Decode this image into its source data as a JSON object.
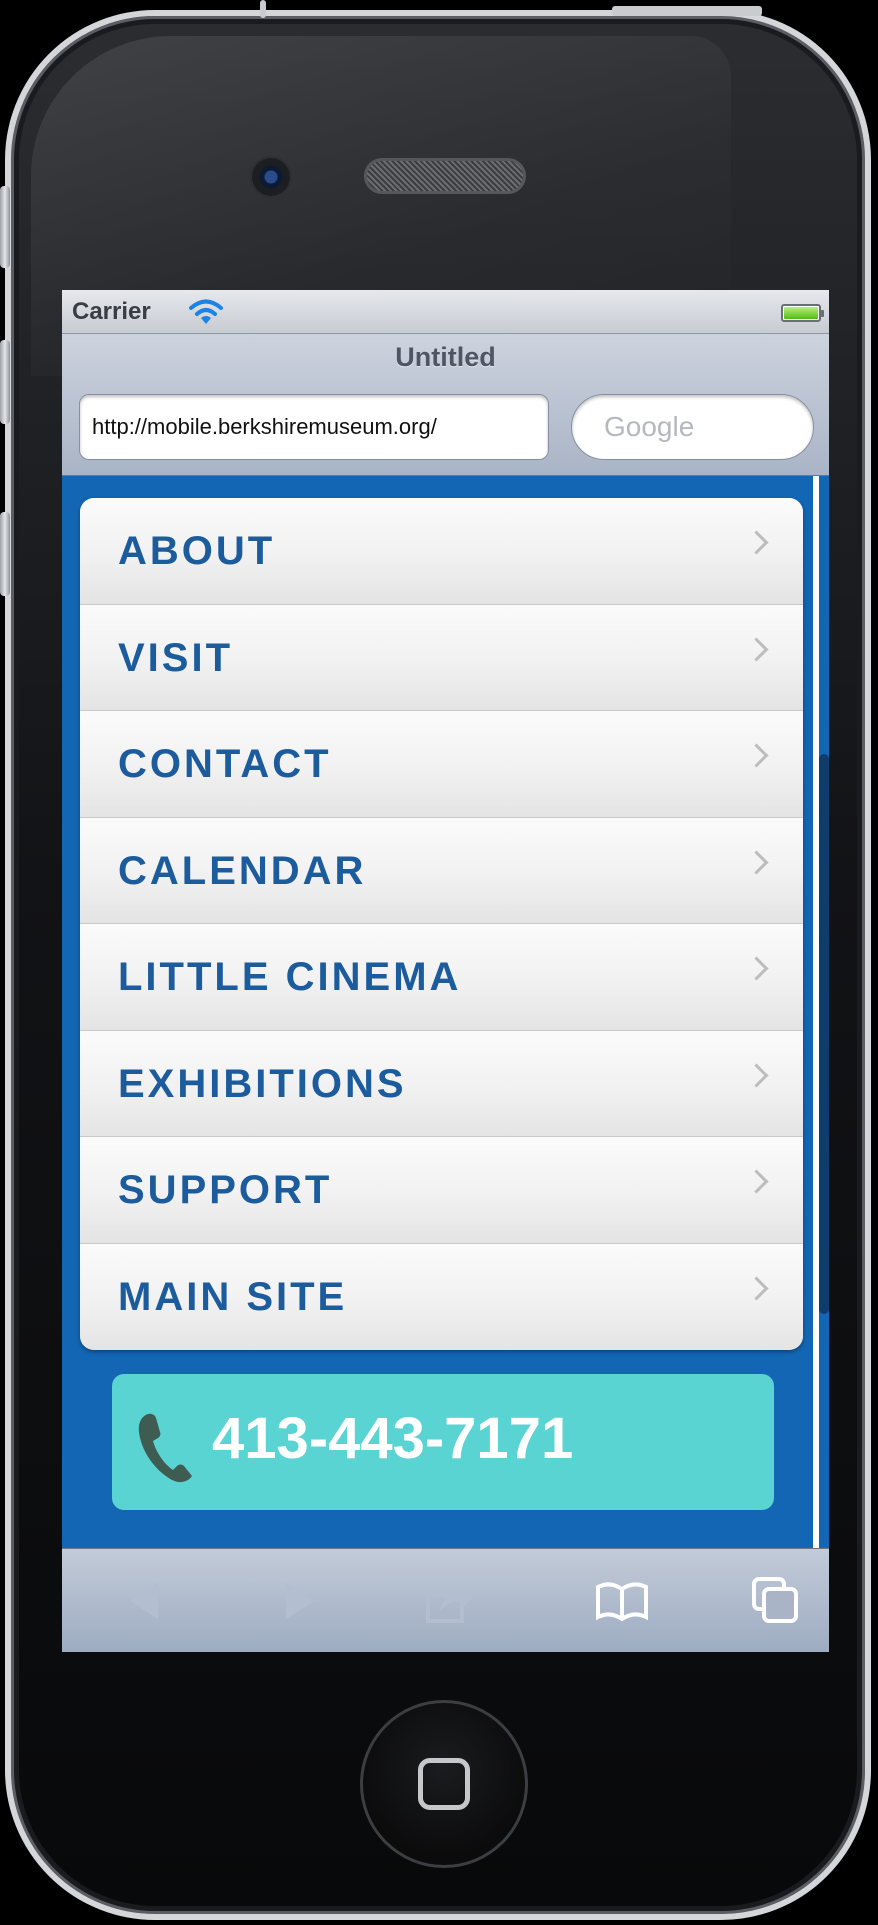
{
  "status_bar": {
    "carrier": "Carrier"
  },
  "browser": {
    "page_title": "Untitled",
    "url": "http://mobile.berkshiremuseum.org/",
    "search_placeholder": "Google"
  },
  "menu": {
    "items": [
      {
        "label": "ABOUT"
      },
      {
        "label": "VISIT"
      },
      {
        "label": "CONTACT"
      },
      {
        "label": "CALENDAR"
      },
      {
        "label": "LITTLE CINEMA"
      },
      {
        "label": "EXHIBITIONS"
      },
      {
        "label": "SUPPORT"
      },
      {
        "label": "MAIN SITE"
      }
    ]
  },
  "call_button": {
    "label": "413-443-7171",
    "icon": "phone-icon"
  },
  "toolbar": {
    "icons": [
      "back-arrow-icon",
      "forward-arrow-icon",
      "share-icon",
      "bookmarks-icon",
      "tabs-icon"
    ]
  },
  "colors": {
    "page_background": "#1366b4",
    "menu_text": "#1d5c9c",
    "call_button": "#5ad3d3"
  }
}
